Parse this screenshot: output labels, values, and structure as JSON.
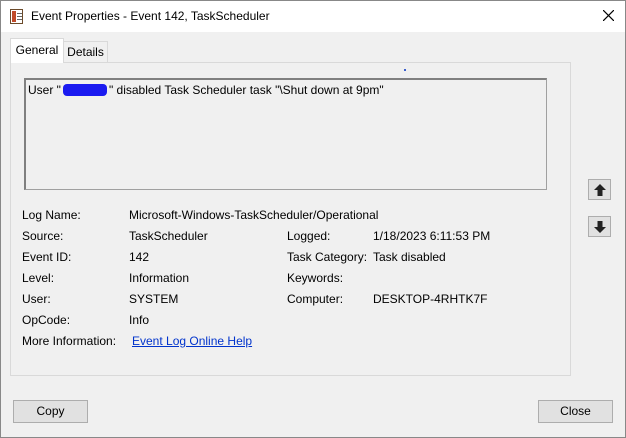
{
  "window": {
    "title": "Event Properties - Event 142, TaskScheduler",
    "icon": "event-viewer-icon"
  },
  "tabs": [
    {
      "label": "General",
      "selected": true
    },
    {
      "label": "Details",
      "selected": false
    }
  ],
  "description": {
    "prefix": "User \"",
    "suffix": "\" disabled Task Scheduler task \"\\Shut down at 9pm\""
  },
  "fields": {
    "log_name": {
      "label": "Log Name:",
      "value": "Microsoft-Windows-TaskScheduler/Operational"
    },
    "source": {
      "label": "Source:",
      "value": "TaskScheduler"
    },
    "logged": {
      "label": "Logged:",
      "value": "1/18/2023 6:11:53 PM"
    },
    "event_id": {
      "label": "Event ID:",
      "value": "142"
    },
    "task_category": {
      "label": "Task Category:",
      "value": "Task disabled"
    },
    "level": {
      "label": "Level:",
      "value": "Information"
    },
    "keywords": {
      "label": "Keywords:",
      "value": ""
    },
    "user": {
      "label": "User:",
      "value": "SYSTEM"
    },
    "computer": {
      "label": "Computer:",
      "value": "DESKTOP-4RHTK7F"
    },
    "opcode": {
      "label": "OpCode:",
      "value": "Info"
    },
    "more_info": {
      "label": "More Information:",
      "value": "Event Log Online Help"
    }
  },
  "buttons": {
    "copy": "Copy",
    "close": "Close"
  },
  "colors": {
    "link": "#0033cc",
    "redaction": "#1a1af0"
  }
}
